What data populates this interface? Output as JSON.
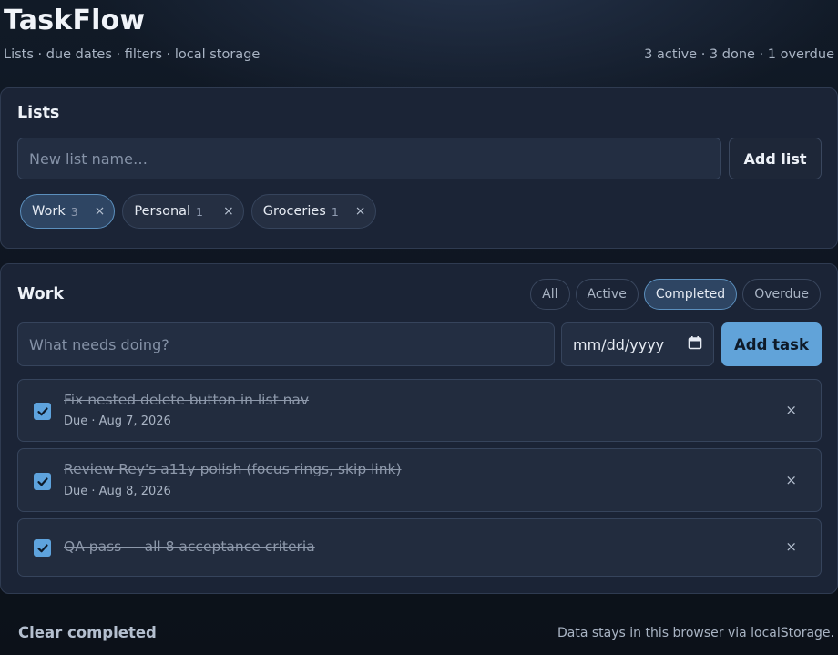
{
  "app": {
    "title": "TaskFlow",
    "subtitle": "Lists · due dates · filters · local storage",
    "stats": "3 active · 3 done · 1 overdue"
  },
  "lists_panel": {
    "heading": "Lists",
    "new_list_placeholder": "New list name…",
    "add_list_label": "Add list",
    "lists": [
      {
        "name": "Work",
        "count": "3",
        "active": true
      },
      {
        "name": "Personal",
        "count": "1",
        "active": false
      },
      {
        "name": "Groceries",
        "count": "1",
        "active": false
      }
    ],
    "close_glyph": "×"
  },
  "tasks_panel": {
    "heading": "Work",
    "filters": [
      {
        "label": "All",
        "active": false
      },
      {
        "label": "Active",
        "active": false
      },
      {
        "label": "Completed",
        "active": true
      },
      {
        "label": "Overdue",
        "active": false
      }
    ],
    "task_placeholder": "What needs doing?",
    "date_placeholder": "mm/dd/yyyy",
    "add_task_label": "Add task",
    "tasks": [
      {
        "text": "Fix nested delete button in list nav",
        "due": "Due · Aug 7, 2026",
        "done": true
      },
      {
        "text": "Review Rey's a11y polish (focus rings, skip link)",
        "due": "Due · Aug 8, 2026",
        "done": true
      },
      {
        "text": "QA pass — all 8 acceptance criteria",
        "due": "",
        "done": true
      }
    ],
    "delete_glyph": "×"
  },
  "footer": {
    "clear_completed_label": "Clear completed",
    "note": "Data stays in this browser via localStorage."
  },
  "colors": {
    "accent": "#61a3d9",
    "background": "#111a27",
    "card": "#1b2436"
  }
}
